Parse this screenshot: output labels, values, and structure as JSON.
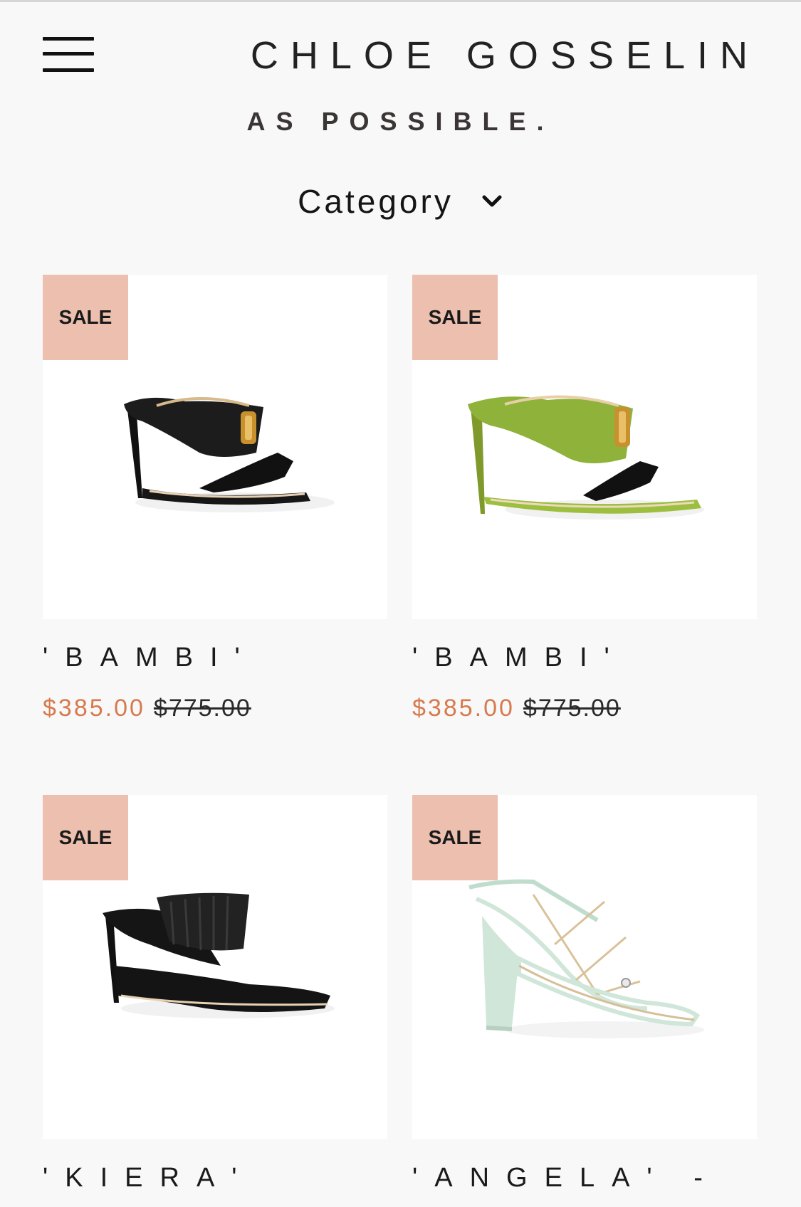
{
  "header": {
    "menu_icon": "hamburger-menu-icon",
    "logo_text": "CHLOE GOSSELIN"
  },
  "tagline": "AS POSSIBLE.",
  "filter": {
    "label": "Category",
    "icon": "chevron-down-icon"
  },
  "colors": {
    "background": "#f8f8f8",
    "badge": "#ecbfae",
    "sale_price": "#d77a4e"
  },
  "products": [
    {
      "badge": "SALE",
      "name": "'BAMBI'",
      "sale_price": "$385.00",
      "original_price": "$775.00",
      "image": "black-satin-mule"
    },
    {
      "badge": "SALE",
      "name": "'BAMBI'",
      "sale_price": "$385.00",
      "original_price": "$775.00",
      "image": "green-satin-mule"
    },
    {
      "badge": "SALE",
      "name": "'KIERA'",
      "image": "black-leather-pointed-mule"
    },
    {
      "badge": "SALE",
      "name": "'ANGELA' -",
      "image": "mint-strappy-block-heel-sandal"
    }
  ]
}
